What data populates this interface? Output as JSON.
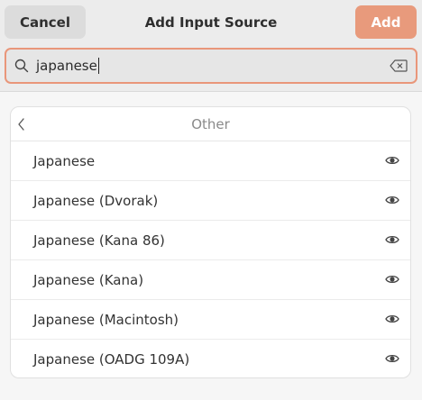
{
  "header": {
    "cancel_label": "Cancel",
    "title": "Add Input Source",
    "add_label": "Add"
  },
  "search": {
    "value": "japanese"
  },
  "list": {
    "category": "Other",
    "items": [
      {
        "label": "Japanese",
        "icon": "eye-icon"
      },
      {
        "label": "Japanese (Dvorak)",
        "icon": "eye-icon"
      },
      {
        "label": "Japanese (Kana 86)",
        "icon": "eye-icon"
      },
      {
        "label": "Japanese (Kana)",
        "icon": "eye-icon"
      },
      {
        "label": "Japanese (Macintosh)",
        "icon": "eye-icon"
      },
      {
        "label": "Japanese (OADG 109A)",
        "icon": "eye-icon"
      }
    ]
  },
  "colors": {
    "accent": "#e9967a",
    "add_button_bg": "#e89a7c",
    "header_bg": "#ececec",
    "window_bg": "#f6f6f6"
  }
}
